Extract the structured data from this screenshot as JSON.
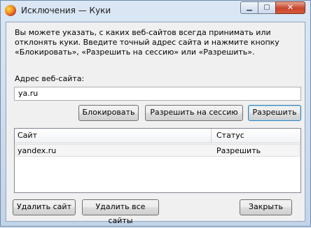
{
  "window": {
    "title": "Исключения — Куки",
    "minimize_glyph": "▁",
    "maximize_glyph": "▢",
    "close_glyph": "✕"
  },
  "dialog": {
    "description": "Вы можете указать, с каких веб-сайтов всегда принимать или отклонять куки. Введите точный адрес сайта и нажмите кнопку «Блокировать», «Разрешить на сессию» или «Разрешить».",
    "site_label": "Адрес веб-сайта:",
    "site_value": "ya.ru",
    "buttons": {
      "block": "Блокировать",
      "allow_session": "Разрешить на сессию",
      "allow": "Разрешить",
      "remove_site": "Удалить сайт",
      "remove_all": "Удалить все сайты",
      "close": "Закрыть"
    }
  },
  "table": {
    "columns": [
      "Сайт",
      "Статус"
    ],
    "rows": [
      {
        "site": "yandex.ru",
        "status": "Разрешить"
      }
    ]
  }
}
